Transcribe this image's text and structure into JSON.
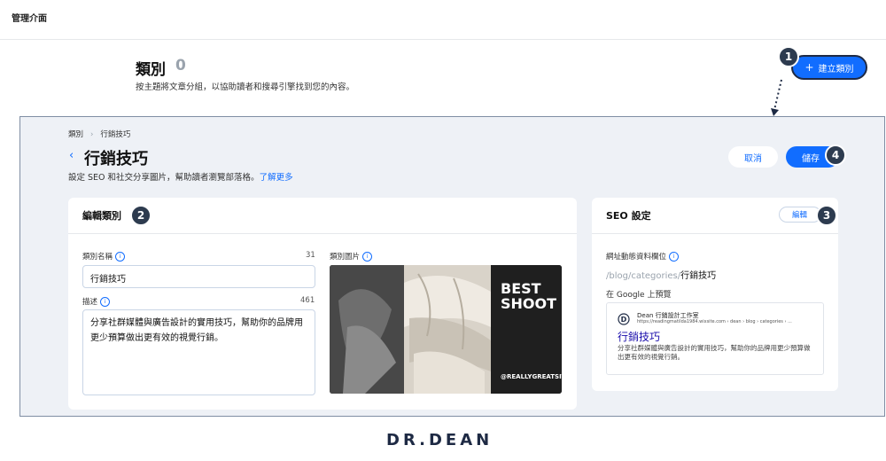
{
  "topbar": {
    "title": "管理介面"
  },
  "header": {
    "title": "類別",
    "count": "0",
    "subtitle": "按主題將文章分組，以協助讀者和搜尋引擎找到您的內容。",
    "create_label": "建立類別",
    "create_icon": "plus-icon"
  },
  "badges": {
    "b1": "1",
    "b2": "2",
    "b3": "3",
    "b4": "4"
  },
  "detail": {
    "breadcrumb_root": "類別",
    "breadcrumb_current": "行銷技巧",
    "title": "行銷技巧",
    "subtitle": "設定 SEO 和社交分享圖片，幫助讀者瀏覽部落格。",
    "learn_more": "了解更多",
    "cancel_label": "取消",
    "save_label": "儲存"
  },
  "edit_card": {
    "title": "編輯類別",
    "name_label": "類別名稱",
    "name_count": "31",
    "name_value": "行銷技巧",
    "desc_label": "描述",
    "desc_count": "461",
    "desc_value": "分享社群媒體與廣告設計的實用技巧，幫助你的品牌用更少預算做出更有效的視覺行銷。",
    "image_label": "類別圖片",
    "image_text_1": "BEST",
    "image_text_2": "SHOOT",
    "image_caption": "@REALLYGREATSITE"
  },
  "seo_card": {
    "title": "SEO 設定",
    "edit_label": "編輯",
    "slug_label": "網址動態資料欄位",
    "slug_prefix": "/blog/categories/",
    "slug_value": "行銷技巧",
    "preview_label": "在 Google 上預覽",
    "preview_site": "Dean 行銷設計工作室",
    "preview_url": "https://readingmatilda1984.wixsite.com › dean › blog › categories › ...",
    "preview_title": "行銷技巧",
    "preview_desc": "分享社群媒體與廣告設計的實用技巧，幫助你的品牌用更少預算做出更有效的視覺行銷。"
  },
  "footer": {
    "logo": "DR.DEAN"
  },
  "colors": {
    "accent": "#116dff",
    "badge": "#2d3b4f",
    "panel_bg": "#eef1f6"
  }
}
